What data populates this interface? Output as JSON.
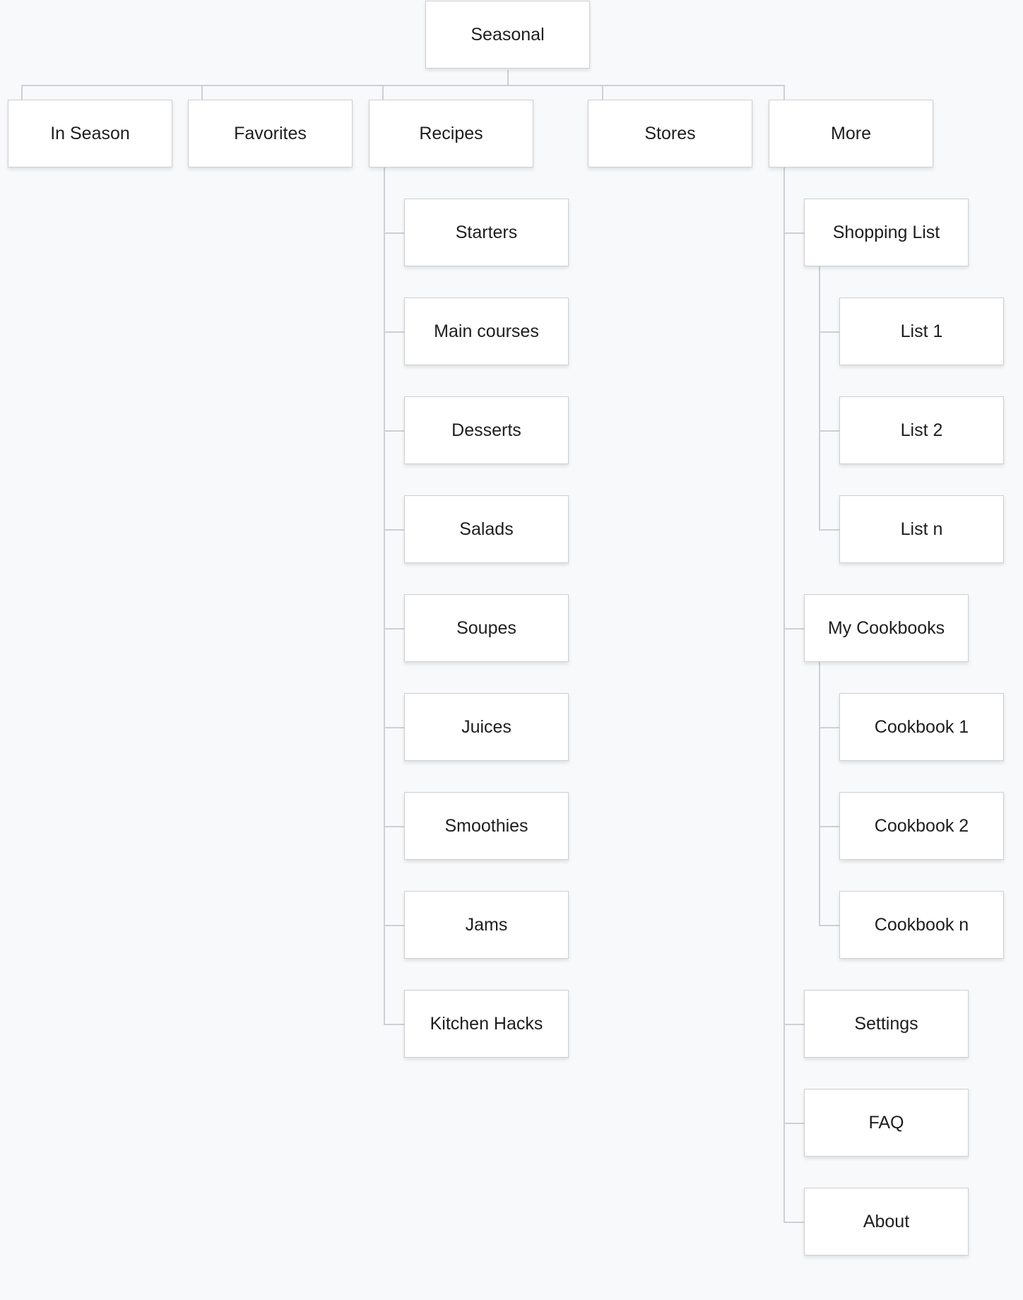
{
  "root": "Seasonal",
  "top_level": [
    "In Season",
    "Favorites",
    "Recipes",
    "Stores",
    "More"
  ],
  "recipes": [
    "Starters",
    "Main courses",
    "Desserts",
    "Salads",
    "Soupes",
    "Juices",
    "Smoothies",
    "Jams",
    "Kitchen Hacks"
  ],
  "more": {
    "shopping_list": "Shopping List",
    "lists": [
      "List 1",
      "List 2",
      "List n"
    ],
    "my_cookbooks": "My Cookbooks",
    "cookbooks": [
      "Cookbook 1",
      "Cookbook 2",
      "Cookbook n"
    ],
    "settings": "Settings",
    "faq": "FAQ",
    "about": "About"
  }
}
